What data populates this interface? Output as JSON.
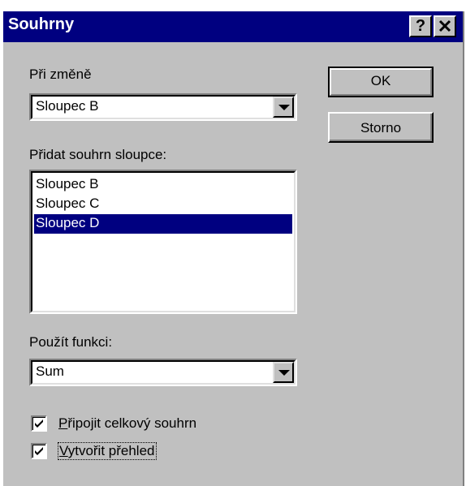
{
  "dialog": {
    "title": "Souhrny",
    "help_button": "?",
    "close_button": "✕"
  },
  "on_change": {
    "label": "Při změně",
    "selected_value": "Sloupec B"
  },
  "add_subtotal": {
    "label": "Přidat souhrn sloupce:",
    "items": [
      {
        "label": "Sloupec B",
        "selected": false
      },
      {
        "label": "Sloupec C",
        "selected": false
      },
      {
        "label": "Sloupec D",
        "selected": true
      }
    ]
  },
  "use_function": {
    "label": "Použít funkci:",
    "selected_value": "Sum"
  },
  "buttons": {
    "ok": "OK",
    "cancel": "Storno"
  },
  "options": {
    "grand_total": {
      "label_mnemonic": "P",
      "label_rest": "řipojit celkový souhrn",
      "checked": true
    },
    "create_outline": {
      "label_mnemonic": "V",
      "label_rest": "ytvořit přehled",
      "checked": true
    }
  },
  "colors": {
    "titlebar": "#000080",
    "face": "#c0c0c0",
    "selection": "#000080"
  },
  "icons": {
    "dropdown": "chevron-down-icon",
    "check": "checkmark-icon"
  }
}
